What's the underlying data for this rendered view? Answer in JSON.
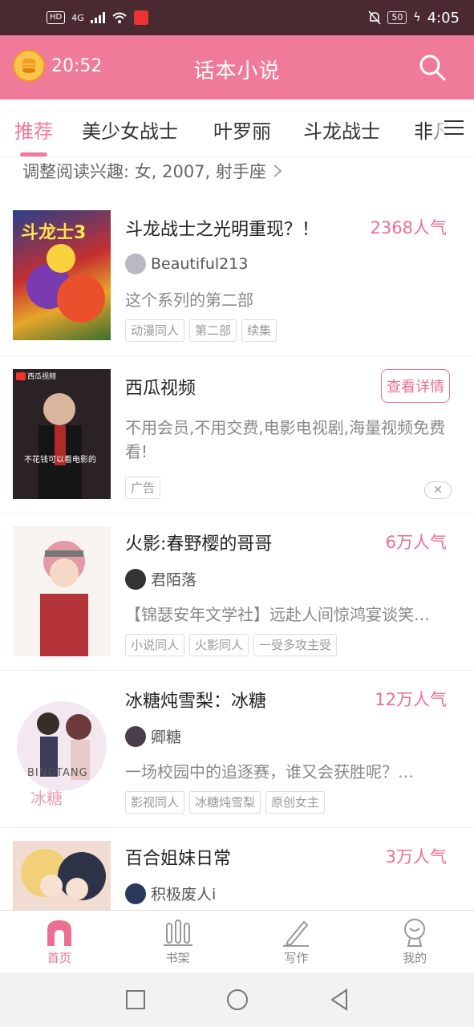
{
  "status_bar": {
    "left_chip": "HD",
    "network": "4G",
    "battery": "50",
    "time": "4:05"
  },
  "header": {
    "time": "20:52",
    "title": "话本小说",
    "accent_color": "#f07a9a"
  },
  "tabs": [
    {
      "label": "推荐",
      "active": true
    },
    {
      "label": "美少女战士"
    },
    {
      "label": "叶罗丽"
    },
    {
      "label": "斗龙战士"
    },
    {
      "label": "非凡"
    }
  ],
  "interest_bar": "调整阅读兴趣: 女, 2007, 射手座",
  "items": [
    {
      "title": "斗龙战士之光明重现？！",
      "popularity": "2368人气",
      "author": "Beautiful213",
      "desc": "这个系列的第二部",
      "tags": [
        "动漫同人",
        "第二部",
        "续集"
      ]
    },
    {
      "title": "西瓜视频",
      "button": "查看详情",
      "desc": "不用会员,不用交费,电影电视剧,海量视频免费看!",
      "tag": "广告",
      "close": "✕",
      "cover_logo": "西瓜视频",
      "cover_caption": "不花钱可以看电影的"
    },
    {
      "title": "火影:春野樱的哥哥",
      "popularity": "6万人气",
      "author": "君陌落",
      "desc": "【锦瑟安年文学社】远赴人间惊鸿宴谈笑…",
      "tags": [
        "小说同人",
        "火影同人",
        "一受多攻主受"
      ]
    },
    {
      "title": "冰糖炖雪梨：冰糖",
      "popularity": "12万人气",
      "author": "卿糖",
      "desc": "一场校园中的追逐赛，谁又会获胜呢？…",
      "tags": [
        "影视同人",
        "冰糖炖雪梨",
        "原创女主"
      ],
      "cover_text": "BINGTANG"
    },
    {
      "title": "百合姐妹日常",
      "popularity": "3万人气",
      "author": "积极废人i"
    }
  ],
  "bottom_nav": [
    {
      "label": "首页",
      "icon": "home-icon",
      "active": true
    },
    {
      "label": "书架",
      "icon": "bookshelf-icon"
    },
    {
      "label": "写作",
      "icon": "pen-icon"
    },
    {
      "label": "我的",
      "icon": "profile-icon"
    }
  ]
}
